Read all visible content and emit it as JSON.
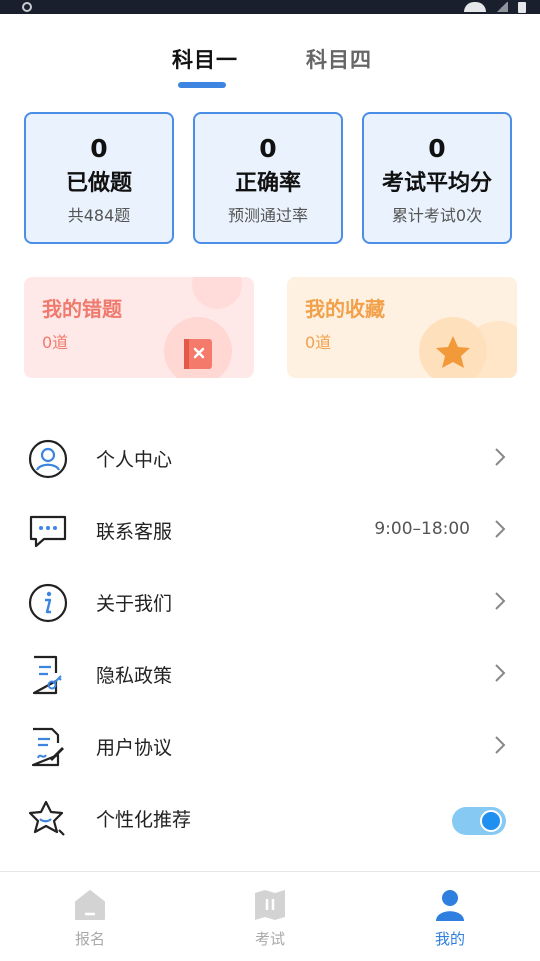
{
  "tabs": [
    {
      "label": "科目一",
      "active": true
    },
    {
      "label": "科目四",
      "active": false
    }
  ],
  "stats": [
    {
      "value": "0",
      "label": "已做题",
      "sub": "共484题"
    },
    {
      "value": "0",
      "label": "正确率",
      "sub": "预测通过率"
    },
    {
      "value": "0",
      "label": "考试平均分",
      "sub": "累计考试0次"
    }
  ],
  "cards": {
    "wrong": {
      "title": "我的错题",
      "count": "0道"
    },
    "favorites": {
      "title": "我的收藏",
      "count": "0道"
    }
  },
  "menu": [
    {
      "label": "个人中心",
      "icon": "user-circle-icon"
    },
    {
      "label": "联系客服",
      "icon": "chat-bubble-icon",
      "extra": "9:00–18:00"
    },
    {
      "label": "关于我们",
      "icon": "info-icon"
    },
    {
      "label": "隐私政策",
      "icon": "document-key-icon"
    },
    {
      "label": "用户协议",
      "icon": "document-sign-icon"
    },
    {
      "label": "个性化推荐",
      "icon": "star-sparkle-icon",
      "toggle": true
    }
  ],
  "nav": [
    {
      "label": "报名",
      "icon": "home-icon"
    },
    {
      "label": "考试",
      "icon": "book-icon"
    },
    {
      "label": "我的",
      "icon": "profile-icon",
      "active": true
    }
  ],
  "colors": {
    "accent": "#3d85e0",
    "wrong": "#ef7a6e",
    "favorite": "#f2a14a"
  }
}
